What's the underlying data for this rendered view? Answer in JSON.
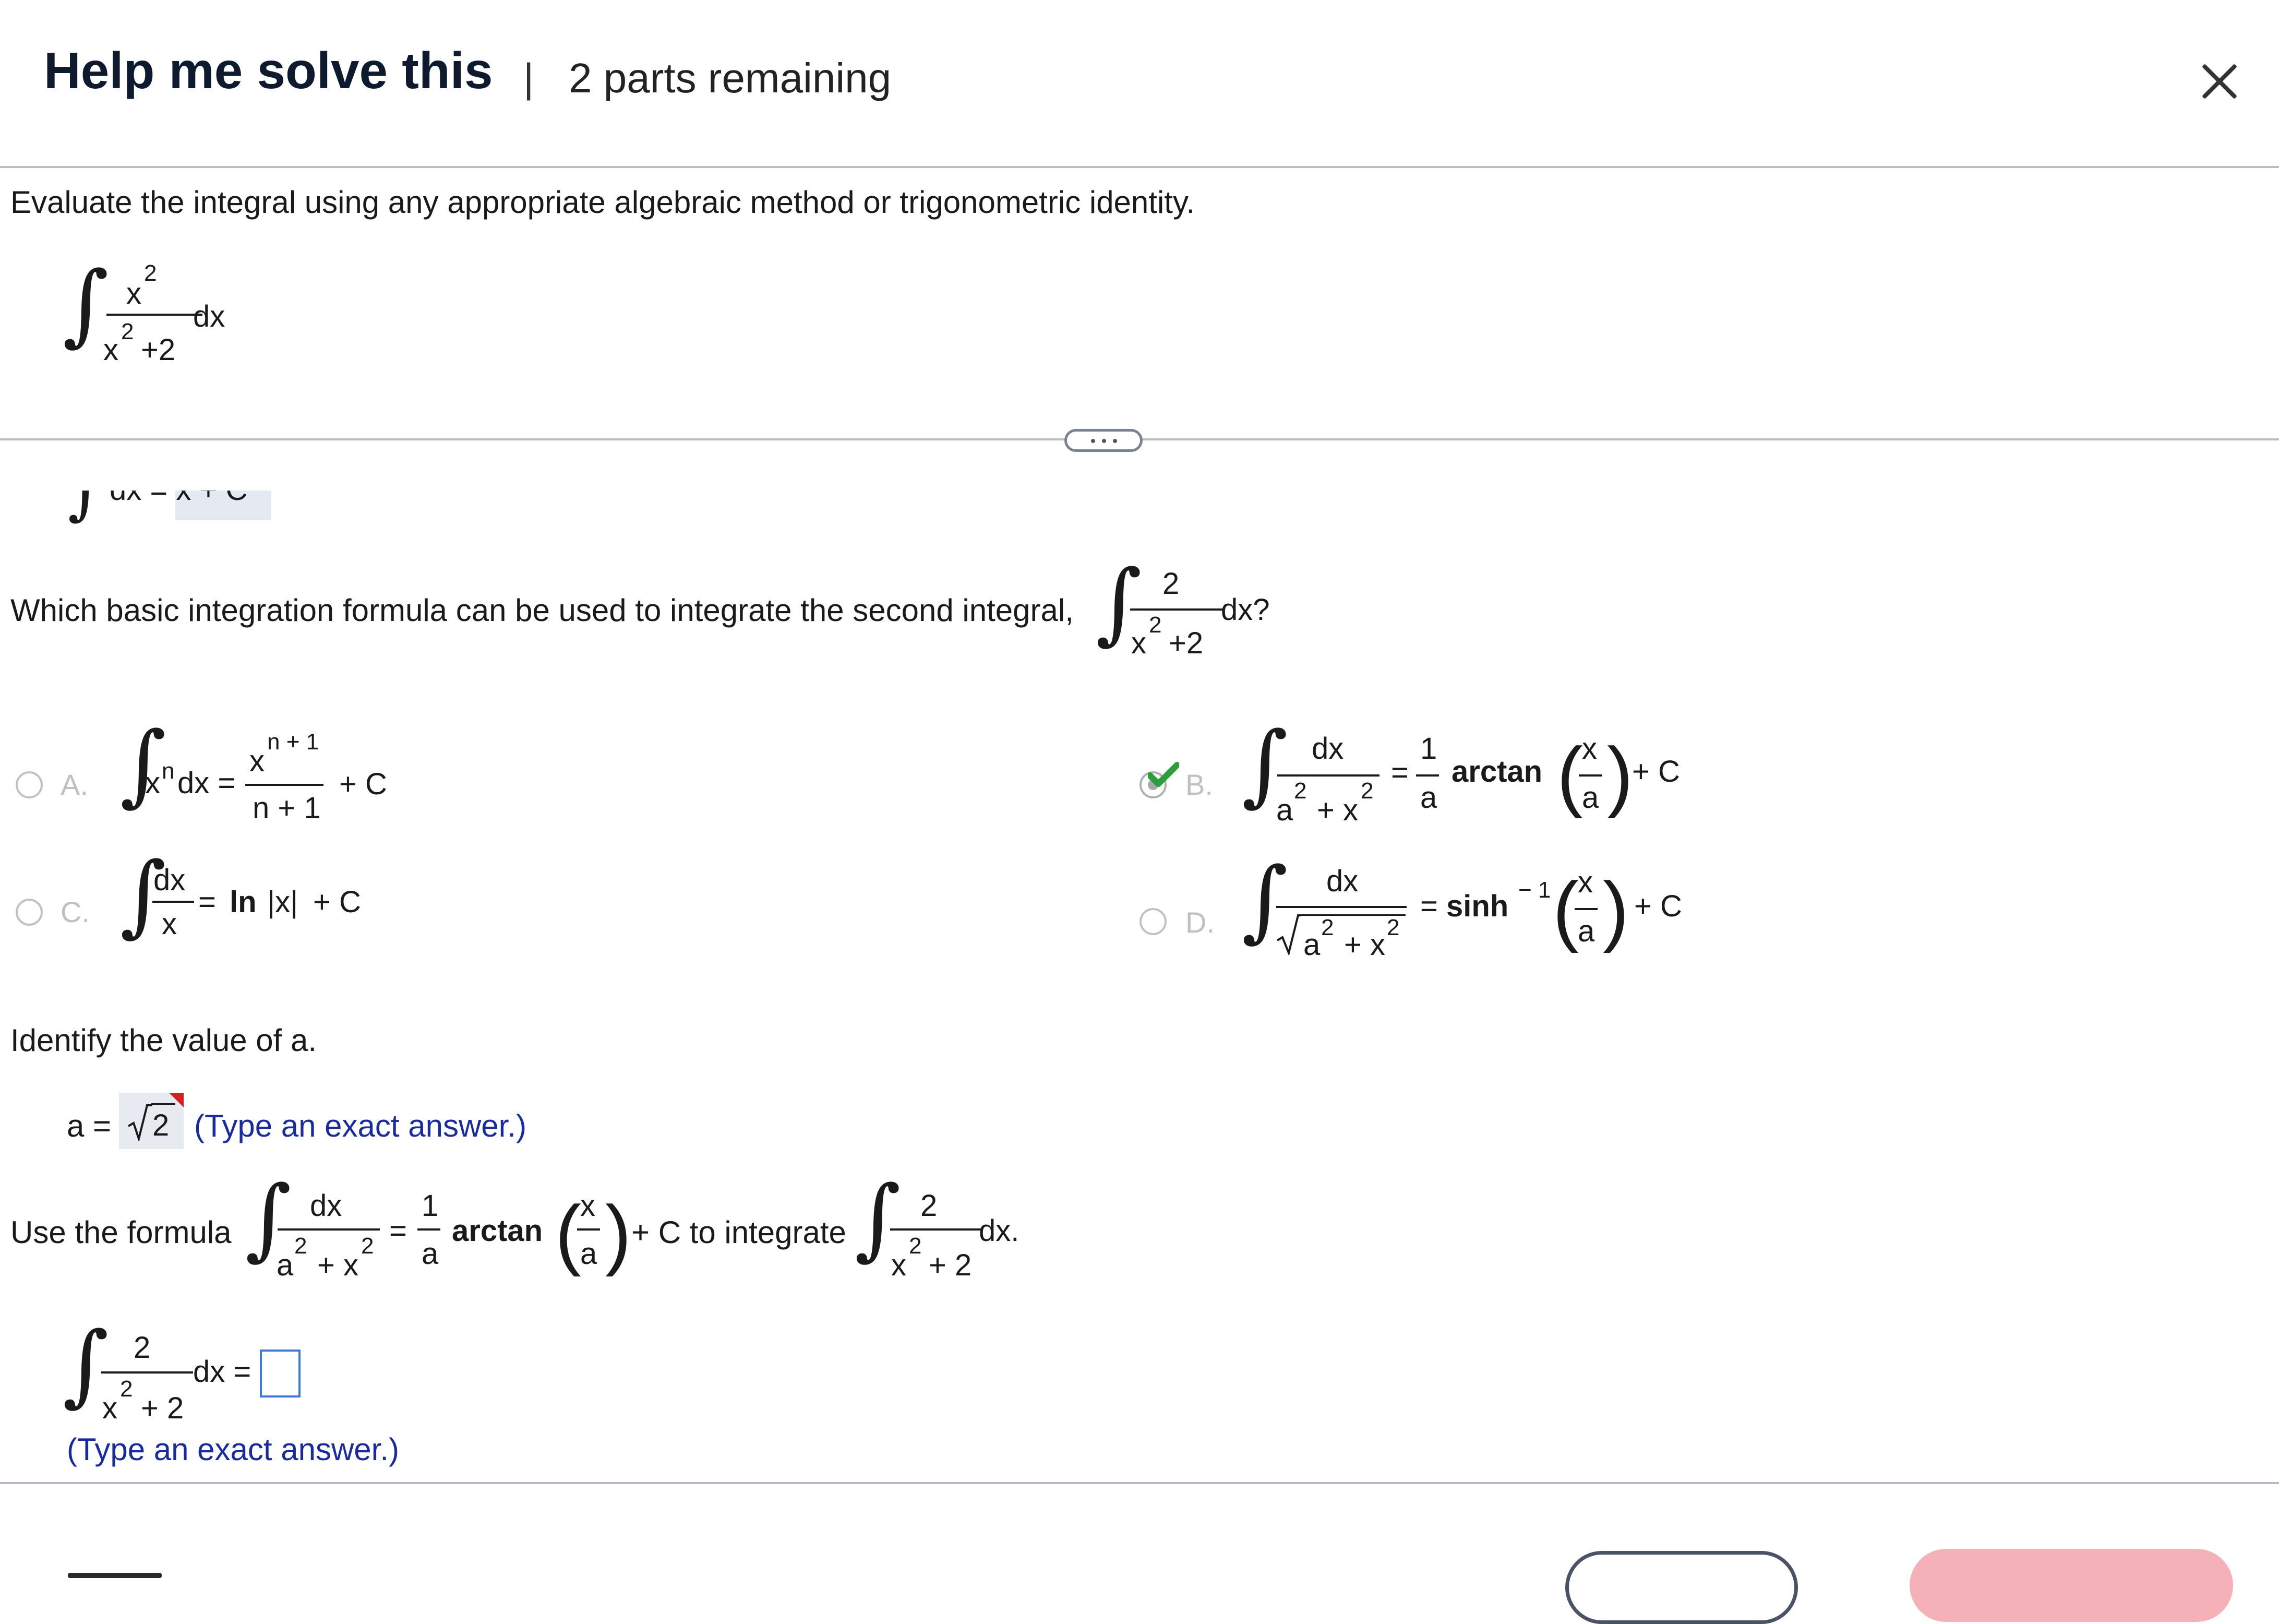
{
  "header": {
    "title": "Help me solve this",
    "separator": "|",
    "parts_remaining": "2 parts remaining"
  },
  "problem": {
    "instruction": "Evaluate the integral using any appropriate algebraic method or trigonometric identity.",
    "integral": {
      "num": "x",
      "num_exp": "2",
      "den_base": "x",
      "den_exp": "2",
      "den_rest": "+2",
      "dx": "dx"
    }
  },
  "partial_prev": {
    "text": "dx = x + C"
  },
  "question1": {
    "prefix": "Which basic integration formula can be used to integrate the second integral,",
    "num": "2",
    "den_base": "x",
    "den_exp": "2",
    "den_rest": "+2",
    "suffix": "dx?"
  },
  "options": {
    "A": {
      "letter": "A.",
      "a1": "x",
      "a2": "n",
      "a3": "dx =",
      "num": "x",
      "num_exp": "n + 1",
      "den": "n + 1",
      "tail": "+ C"
    },
    "B": {
      "letter": "B.",
      "num": "dx",
      "den_a": "a",
      "den_e1": "2",
      "den_plus": "+ x",
      "den_e2": "2",
      "eq": "=",
      "one": "1",
      "a": "a",
      "fn": "arctan",
      "px": "x",
      "pa": "a",
      "tail": "+ C",
      "selected": true
    },
    "C": {
      "letter": "C.",
      "num": "dx",
      "den": "x",
      "eq": "=",
      "fn": "ln",
      "abs": "|x|",
      "tail": "+ C"
    },
    "D": {
      "letter": "D.",
      "num": "dx",
      "den_a": "a",
      "den_e1": "2",
      "den_plus": "+ x",
      "den_e2": "2",
      "eq": "=",
      "fn": "sinh",
      "exp": "− 1",
      "px": "x",
      "pa": "a",
      "tail": "+ C"
    }
  },
  "question2": {
    "prompt": "Identify the value of a.",
    "lhs": "a =",
    "answer": "2",
    "hint": "(Type an exact answer.)"
  },
  "question3": {
    "use": "Use the formula",
    "num": "dx",
    "den_a": "a",
    "den_e1": "2",
    "den_plus": "+ x",
    "den_e2": "2",
    "eq": "=",
    "one": "1",
    "a": "a",
    "fn": "arctan",
    "px": "x",
    "pa": "a",
    "mid": "+ C to integrate",
    "num2": "2",
    "den2_base": "x",
    "den2_exp": "2",
    "den2_rest": "+ 2",
    "end": "dx."
  },
  "question4": {
    "num": "2",
    "den_base": "x",
    "den_exp": "2",
    "den_rest": "+ 2",
    "dx": "dx =",
    "hint": "(Type an exact answer.)"
  },
  "colors": {
    "accent_blue": "#1a2aa0",
    "check_green": "#2e9e3a",
    "flag_red": "#d42020",
    "divider": "#b9bcc2"
  }
}
